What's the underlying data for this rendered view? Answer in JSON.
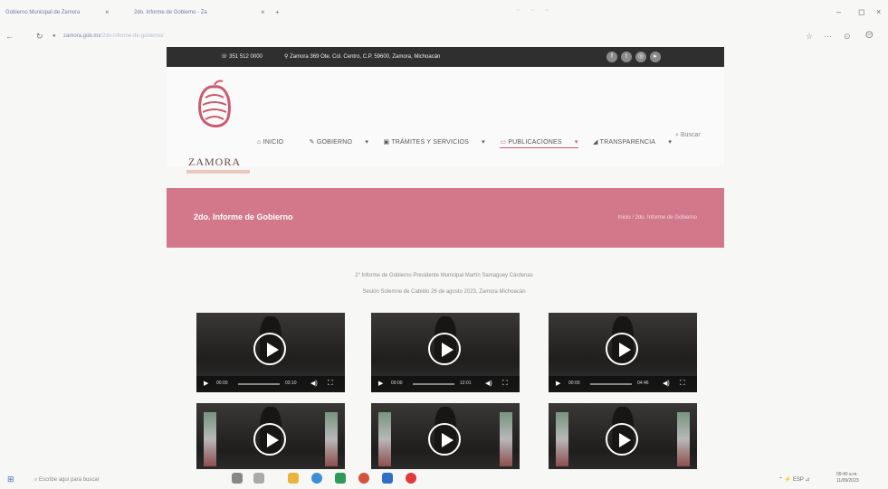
{
  "browser": {
    "tab1_title": "Gobierno Municipal de Zamora",
    "tab2_title": "2do. Informe de Gobierno - Za",
    "url_host": "zamora.gob.mx",
    "url_path": "/2do-informe-de-gobierno/"
  },
  "topbar": {
    "phone": "351 512 0000",
    "address": "Zamora 369 Ote. Col. Centro, C.P. 59600, Zamora, Michoacán"
  },
  "logo": {
    "text": "ZAMORA"
  },
  "menu": {
    "items": [
      "INICIO",
      "GOBIERNO",
      "TRÁMITES Y SERVICIOS",
      "PUBLICACIONES",
      "TRANSPARENCIA"
    ],
    "active": "PUBLICACIONES",
    "search_label": "Buscar"
  },
  "banner": {
    "title": "2do. Informe de Gobierno",
    "breadcrumb": "Inicio  /  2do. Informe de Gobierno"
  },
  "caption": {
    "line1": "2° Informe de Gobierno Presidente Municipal Martín Samaguey Cárdenas",
    "line2": "Sesión Solemne de Cabildo 26 de agosto 2023, Zamora Michoacán"
  },
  "videos": [
    {
      "time_current": "00:00",
      "time_total": "03:10"
    },
    {
      "time_current": "00:00",
      "time_total": "12:01"
    },
    {
      "time_current": "00:00",
      "time_total": "04:46"
    },
    {
      "time_current": "",
      "time_total": ""
    },
    {
      "time_current": "",
      "time_total": ""
    },
    {
      "time_current": "",
      "time_total": ""
    }
  ],
  "taskbar": {
    "search_placeholder": "Escribe aquí para buscar",
    "time": "09:40 a.m.",
    "date": "11/09/2023"
  },
  "colors": {
    "banner": "#d2788a",
    "accent": "#c65c6f",
    "topbar": "#2f2f2f"
  }
}
